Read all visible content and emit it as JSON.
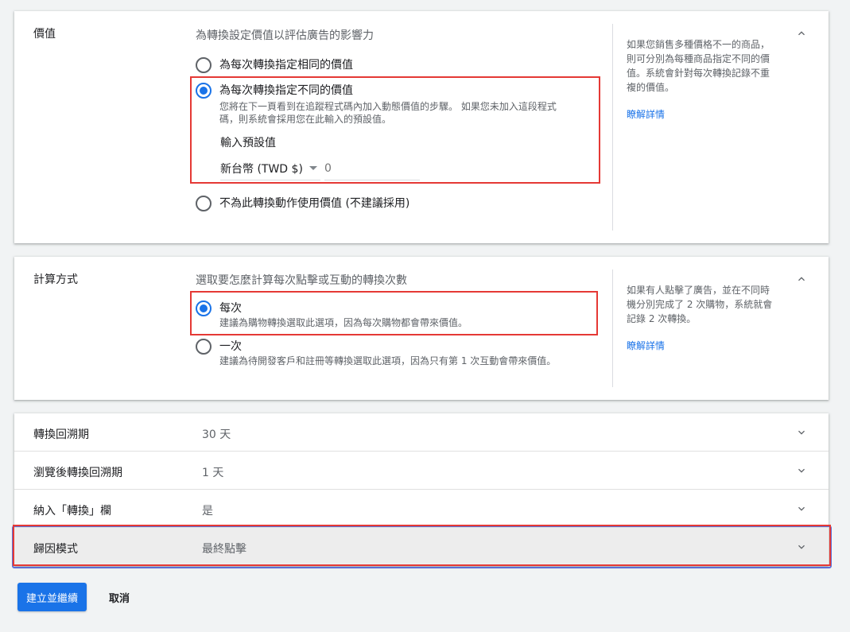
{
  "value_section": {
    "title": "價值",
    "description": "為轉換設定價值以評估廣告的影響力",
    "options": [
      {
        "label": "為每次轉換指定相同的價值",
        "selected": false
      },
      {
        "label": "為每次轉換指定不同的價值",
        "selected": true,
        "sub_line1": "您將在下一頁看到在追蹤程式碼內加入動態價值的步驟。 如果您未加入這段程式",
        "sub_line2": "碼，則系統會採用您在此輸入的預設值。"
      },
      {
        "label": "不為此轉換動作使用價值 (不建議採用)",
        "selected": false
      }
    ],
    "default_value_label": "輸入預設值",
    "currency": "新台幣 (TWD $)",
    "amount_placeholder": "0",
    "help_text": "如果您銷售多種價格不一的商品，則可分別為每種商品指定不同的價值。系統會針對每次轉換記錄不重複的價值。",
    "learn_more": "瞭解詳情"
  },
  "count_section": {
    "title": "計算方式",
    "description": "選取要怎麼計算每次點擊或互動的轉換次數",
    "options": [
      {
        "label": "每次",
        "sub": "建議為購物轉換選取此選項，因為每次購物都會帶來價值。",
        "selected": true
      },
      {
        "label": "一次",
        "sub": "建議為待開發客戶和註冊等轉換選取此選項，因為只有第 1 次互動會帶來價值。",
        "selected": false
      }
    ],
    "help_text": "如果有人點擊了廣告，並在不同時機分別完成了 2 次購物，系統就會記錄 2 次轉換。",
    "learn_more": "瞭解詳情"
  },
  "settings_rows": [
    {
      "label": "轉換回溯期",
      "value": "30 天"
    },
    {
      "label": "瀏覽後轉換回溯期",
      "value": "1 天"
    },
    {
      "label": "納入「轉換」欄",
      "value": "是"
    },
    {
      "label": "歸因模式",
      "value": "最終點擊"
    }
  ],
  "actions": {
    "create_continue": "建立並繼續",
    "cancel": "取消"
  },
  "icons": {
    "collapse": "chevron-up-icon",
    "expand": "chevron-down-icon"
  },
  "colors": {
    "accent": "#1a73e8",
    "highlight_border": "#e53935"
  }
}
